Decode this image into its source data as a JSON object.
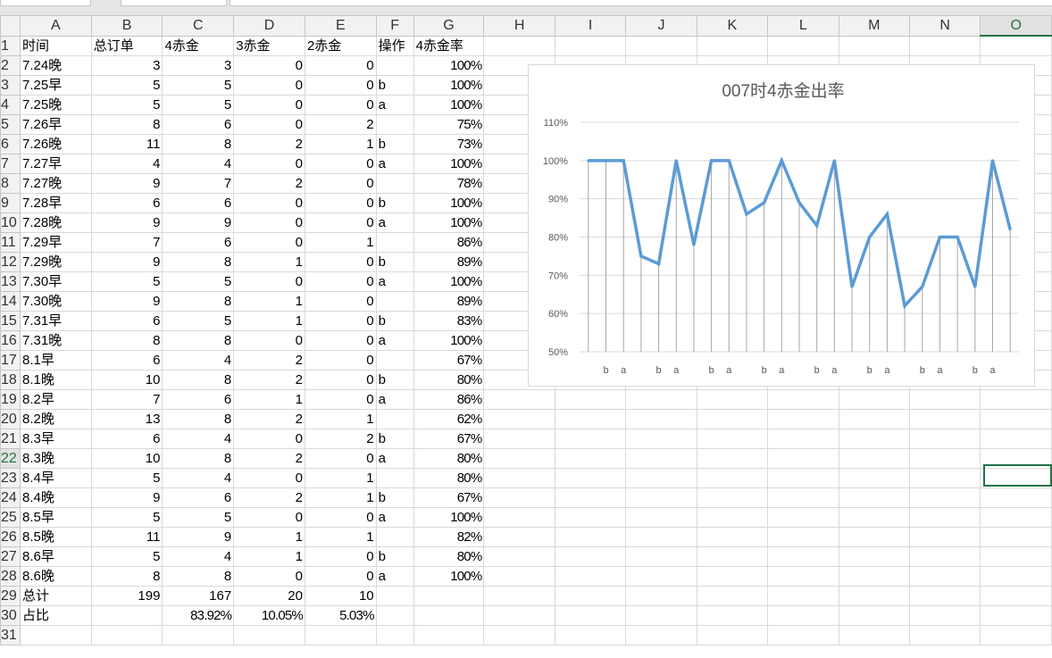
{
  "columns": [
    "A",
    "B",
    "C",
    "D",
    "E",
    "F",
    "G",
    "H",
    "I",
    "J",
    "K",
    "L",
    "M",
    "N",
    "O"
  ],
  "selected_cell": "O22",
  "rows": [
    [
      "时间",
      "总订单",
      "4赤金",
      "3赤金",
      "2赤金",
      "操作",
      "4赤金率"
    ],
    [
      "7.24晚",
      "3",
      "3",
      "0",
      "0",
      "",
      "100%"
    ],
    [
      "7.25早",
      "5",
      "5",
      "0",
      "0",
      "b",
      "100%"
    ],
    [
      "7.25晚",
      "5",
      "5",
      "0",
      "0",
      "a",
      "100%"
    ],
    [
      "7.26早",
      "8",
      "6",
      "0",
      "2",
      "",
      "75%"
    ],
    [
      "7.26晚",
      "11",
      "8",
      "2",
      "1",
      "b",
      "73%"
    ],
    [
      "7.27早",
      "4",
      "4",
      "0",
      "0",
      "a",
      "100%"
    ],
    [
      "7.27晚",
      "9",
      "7",
      "2",
      "0",
      "",
      "78%"
    ],
    [
      "7.28早",
      "6",
      "6",
      "0",
      "0",
      "b",
      "100%"
    ],
    [
      "7.28晚",
      "9",
      "9",
      "0",
      "0",
      "a",
      "100%"
    ],
    [
      "7.29早",
      "7",
      "6",
      "0",
      "1",
      "",
      "86%"
    ],
    [
      "7.29晚",
      "9",
      "8",
      "1",
      "0",
      "b",
      "89%"
    ],
    [
      "7.30早",
      "5",
      "5",
      "0",
      "0",
      "a",
      "100%"
    ],
    [
      "7.30晚",
      "9",
      "8",
      "1",
      "0",
      "",
      "89%"
    ],
    [
      "7.31早",
      "6",
      "5",
      "1",
      "0",
      "b",
      "83%"
    ],
    [
      "7.31晚",
      "8",
      "8",
      "0",
      "0",
      "a",
      "100%"
    ],
    [
      "8.1早",
      "6",
      "4",
      "2",
      "0",
      "",
      "67%"
    ],
    [
      "8.1晚",
      "10",
      "8",
      "2",
      "0",
      "b",
      "80%"
    ],
    [
      "8.2早",
      "7",
      "6",
      "1",
      "0",
      "a",
      "86%"
    ],
    [
      "8.2晚",
      "13",
      "8",
      "2",
      "1",
      "",
      "62%"
    ],
    [
      "8.3早",
      "6",
      "4",
      "0",
      "2",
      "b",
      "67%"
    ],
    [
      "8.3晚",
      "10",
      "8",
      "2",
      "0",
      "a",
      "80%"
    ],
    [
      "8.4早",
      "5",
      "4",
      "0",
      "1",
      "",
      "80%"
    ],
    [
      "8.4晚",
      "9",
      "6",
      "2",
      "1",
      "b",
      "67%"
    ],
    [
      "8.5早",
      "5",
      "5",
      "0",
      "0",
      "a",
      "100%"
    ],
    [
      "8.5晚",
      "11",
      "9",
      "1",
      "1",
      "",
      "82%"
    ],
    [
      "8.6早",
      "5",
      "4",
      "1",
      "0",
      "b",
      "80%"
    ],
    [
      "8.6晚",
      "8",
      "8",
      "0",
      "0",
      "a",
      "100%"
    ],
    [
      "总计",
      "199",
      "167",
      "20",
      "10",
      "",
      ""
    ],
    [
      "占比",
      "",
      "83.92%",
      "10.05%",
      "5.03%",
      "",
      ""
    ]
  ],
  "chart_data": {
    "type": "line",
    "title": "007时4赤金出率",
    "categories": [
      "",
      "b",
      "a",
      "",
      "b",
      "a",
      "",
      "b",
      "a",
      "",
      "b",
      "a",
      "",
      "b",
      "a",
      "",
      "b",
      "a",
      "",
      "b",
      "a",
      "",
      "b",
      "a",
      ""
    ],
    "series": [
      {
        "name": "4赤金率",
        "values": [
          100,
          100,
          100,
          75,
          73,
          100,
          78,
          100,
          100,
          86,
          89,
          100,
          89,
          83,
          100,
          67,
          80,
          86,
          62,
          67,
          80,
          80,
          67,
          100,
          82
        ]
      }
    ],
    "ylim": [
      50,
      110
    ],
    "yticks": [
      "50%",
      "60%",
      "70%",
      "80%",
      "90%",
      "100%",
      "110%"
    ],
    "grid": true,
    "drop_lines": true,
    "line_color": "#5b9bd5"
  }
}
